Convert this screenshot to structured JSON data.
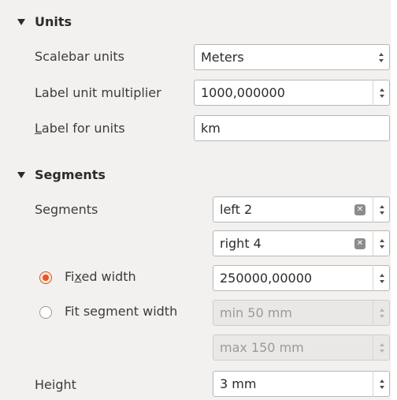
{
  "units": {
    "header": "Units",
    "scalebar_units_label": "Scalebar units",
    "scalebar_units_value": "Meters",
    "multiplier_label": "Label unit multiplier",
    "multiplier_value": "1000,000000",
    "label_for_units_label_first": "L",
    "label_for_units_label_rest": "abel for units",
    "label_for_units_value": "km"
  },
  "segments": {
    "header": "Segments",
    "segments_label": "Segments",
    "left_value": "left 2",
    "right_value": "right 4",
    "fixed_width_label_pre": "Fi",
    "fixed_width_label_u": "x",
    "fixed_width_label_post": "ed width",
    "fixed_width_value": "250000,00000",
    "fit_width_label": "Fit segment width",
    "min_value": "min 50 mm",
    "max_value": "max 150 mm",
    "height_label": "Height",
    "height_value": "3 mm",
    "mode_selected": "Fixed width"
  },
  "icons": {
    "clear": "clear-icon",
    "collapse": "triangle-down-icon"
  }
}
